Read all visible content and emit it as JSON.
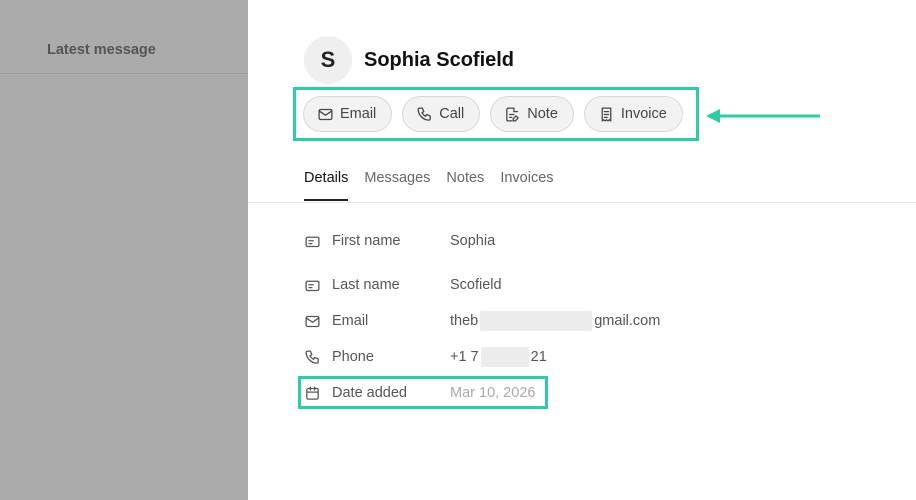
{
  "sidebar": {
    "header_label": "Latest message"
  },
  "contact": {
    "initial": "S",
    "name": "Sophia Scofield"
  },
  "actions": [
    {
      "label": "Email",
      "icon": "mail-icon"
    },
    {
      "label": "Call",
      "icon": "phone-icon"
    },
    {
      "label": "Note",
      "icon": "note-icon"
    },
    {
      "label": "Invoice",
      "icon": "receipt-icon"
    }
  ],
  "tabs": [
    {
      "label": "Details",
      "active": true
    },
    {
      "label": "Messages",
      "active": false
    },
    {
      "label": "Notes",
      "active": false
    },
    {
      "label": "Invoices",
      "active": false
    }
  ],
  "details": {
    "first_name": {
      "label": "First name",
      "value": "Sophia"
    },
    "last_name": {
      "label": "Last name",
      "value": "Scofield"
    },
    "email": {
      "label": "Email",
      "value_prefix": "theb",
      "value_suffix": "gmail.com"
    },
    "phone": {
      "label": "Phone",
      "value_prefix": "+1 7",
      "value_suffix": "21"
    },
    "date_added": {
      "label": "Date added",
      "value": "Mar 10, 2026"
    }
  },
  "colors": {
    "highlight": "#2ecca5",
    "sidebar_overlay": "#ababab"
  }
}
